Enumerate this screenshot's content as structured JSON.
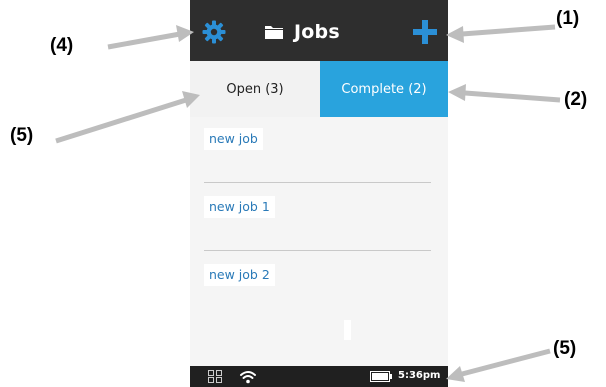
{
  "header": {
    "title": "Jobs",
    "settings_icon": "gear-icon",
    "folder_icon": "folder-icon",
    "add_icon": "plus-icon",
    "accent_color": "#2b8fd6"
  },
  "tabs": [
    {
      "label": "Open",
      "count": "(3)",
      "selected": true
    },
    {
      "label": "Complete",
      "count": "(2)",
      "selected": false,
      "color": "#29a3dd"
    }
  ],
  "jobs": [
    {
      "name": "new job"
    },
    {
      "name": "new job 1"
    },
    {
      "name": "new job 2"
    }
  ],
  "status_bar": {
    "time": "5:36pm",
    "icons": [
      "grid-icon",
      "wifi-icon",
      "battery-icon"
    ]
  },
  "annotations": {
    "add": "(1)",
    "complete_tab": "(2)",
    "settings": "(4)",
    "open_tab": "(5)",
    "status_bar": "(5)"
  }
}
